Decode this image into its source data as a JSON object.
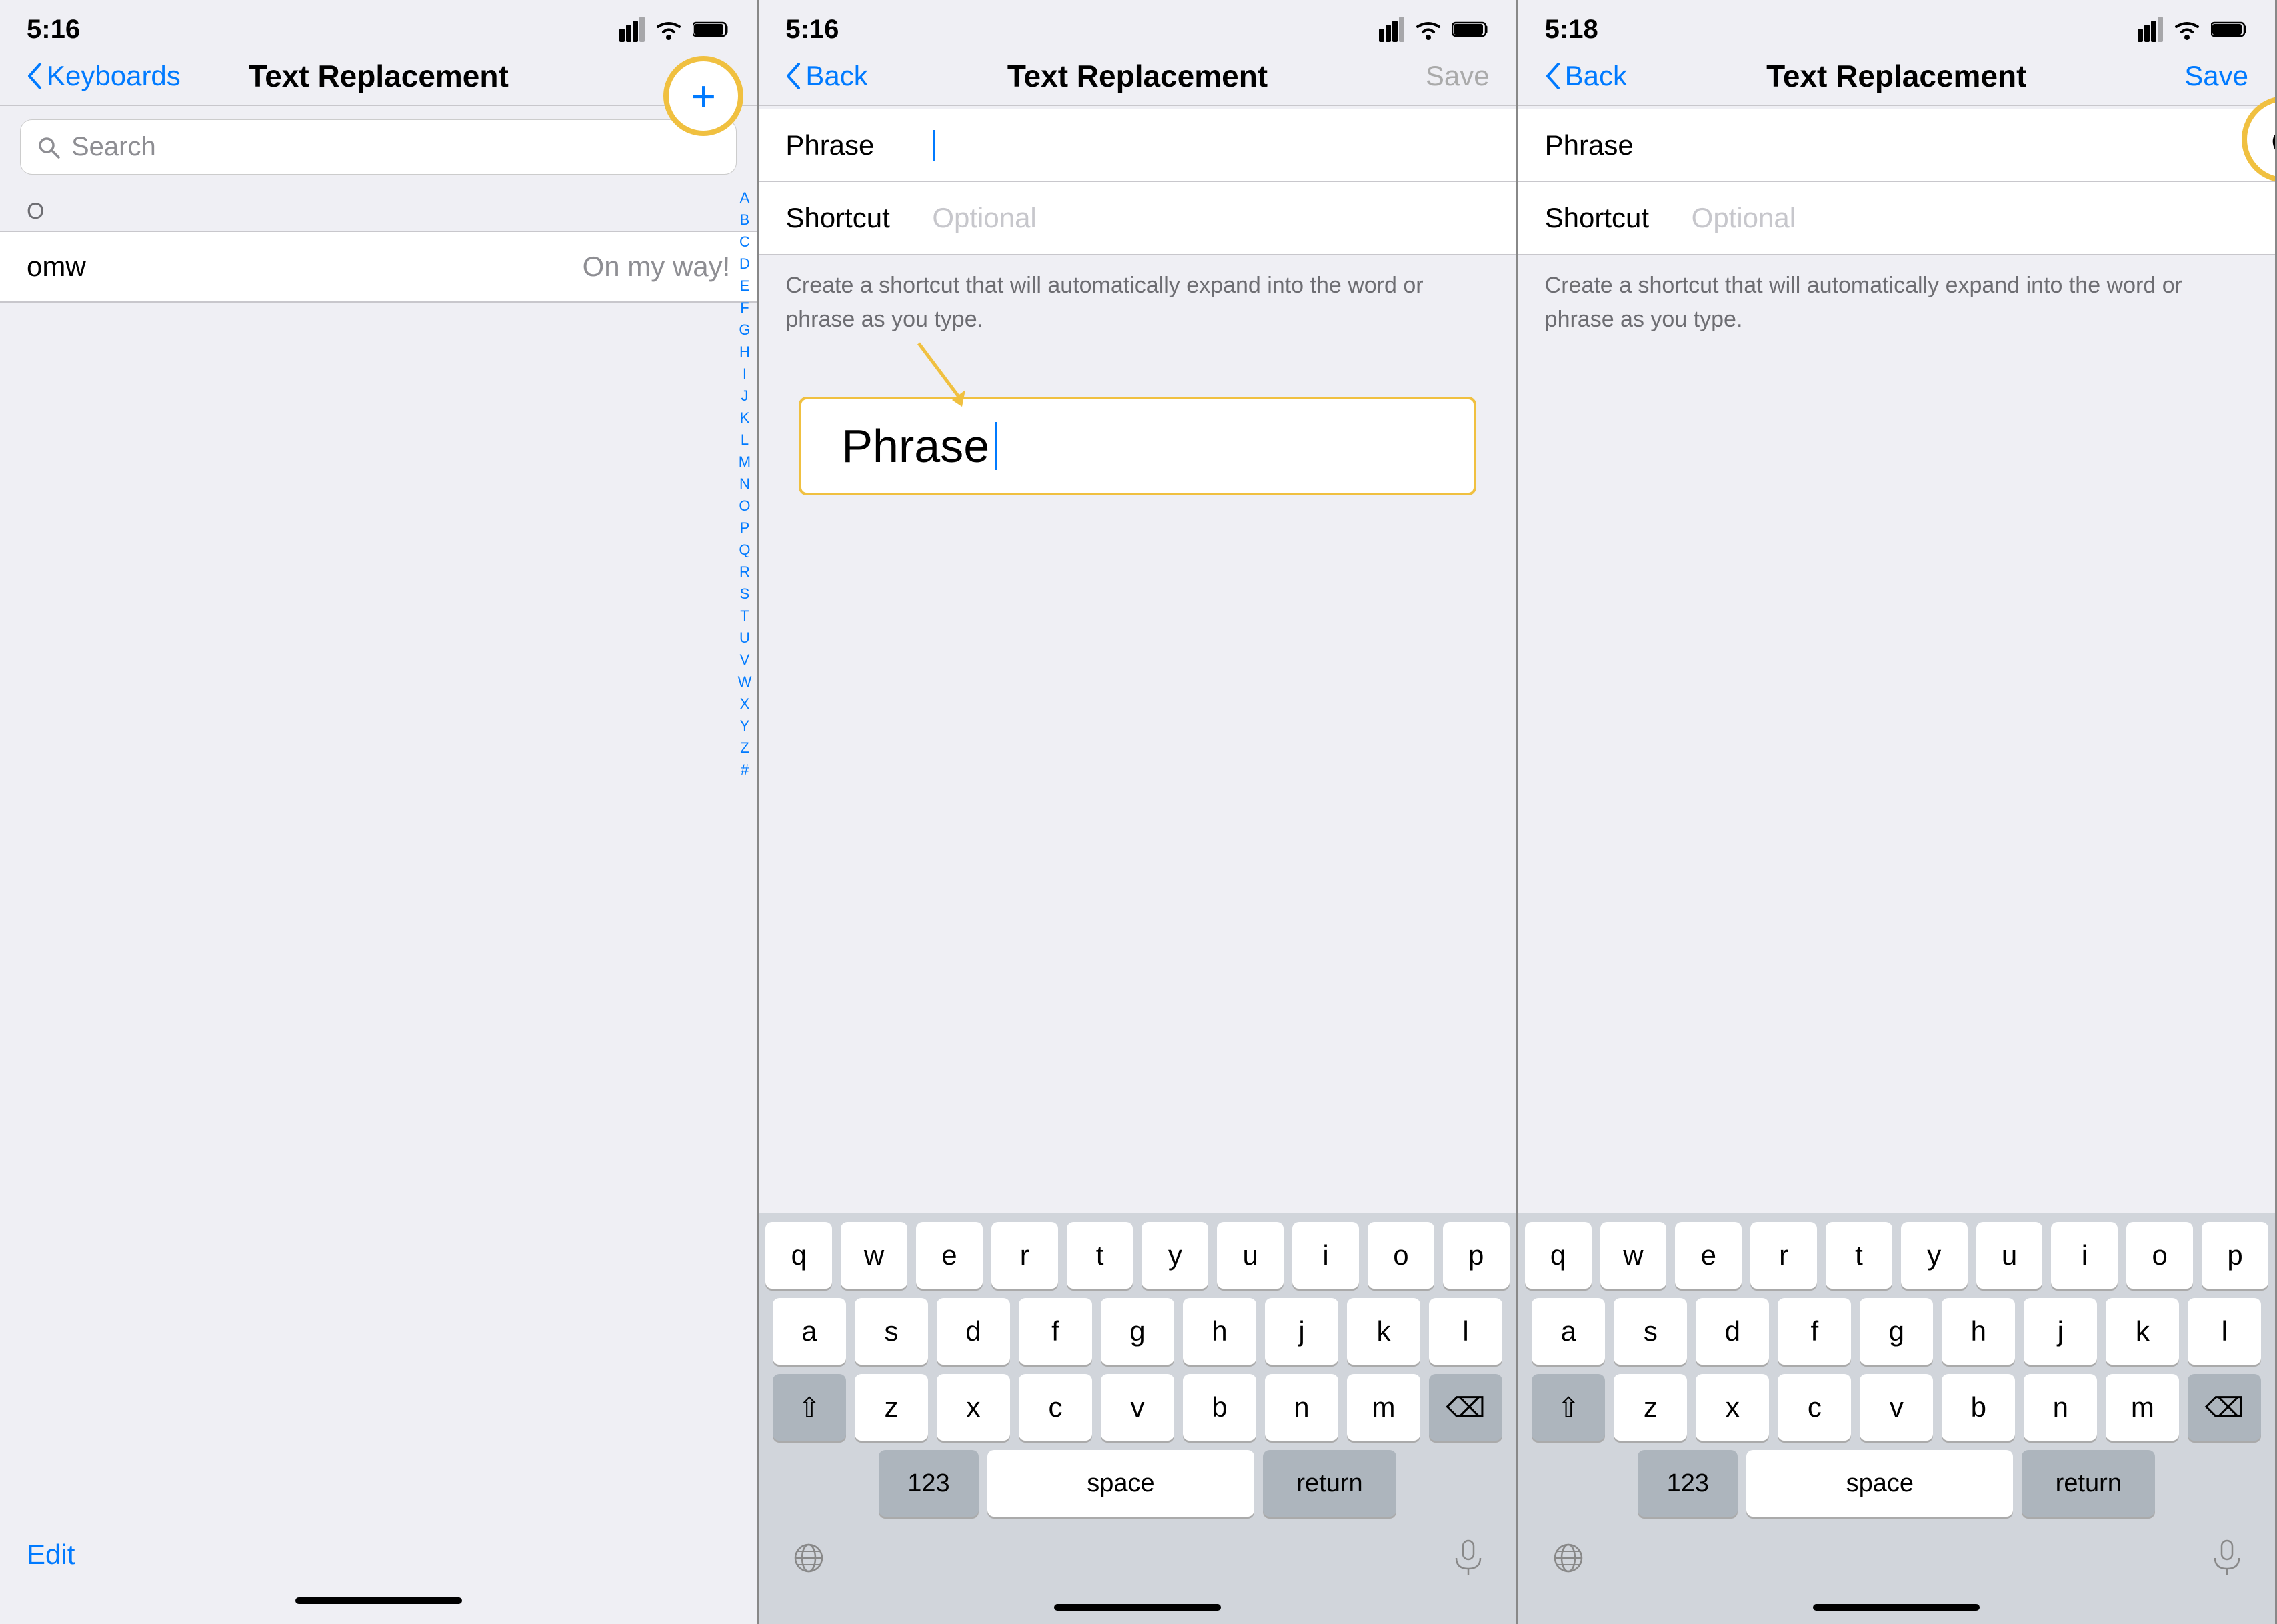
{
  "panels": [
    {
      "id": "panel1",
      "statusBar": {
        "time": "5:16",
        "hasLocation": true
      },
      "nav": {
        "back": "Keyboards",
        "title": "Text Replacement",
        "action": "+",
        "actionType": "add"
      },
      "search": {
        "placeholder": "Search"
      },
      "listSectionHeader": "O",
      "listItems": [
        {
          "label": "omw",
          "value": "On my way!"
        }
      ],
      "alphabetIndex": [
        "A",
        "B",
        "C",
        "D",
        "E",
        "F",
        "G",
        "H",
        "I",
        "J",
        "K",
        "L",
        "M",
        "N",
        "O",
        "P",
        "Q",
        "R",
        "S",
        "T",
        "U",
        "V",
        "W",
        "X",
        "Y",
        "Z",
        "#"
      ],
      "editLabel": "Edit",
      "annotationLabel": "+"
    },
    {
      "id": "panel2",
      "statusBar": {
        "time": "5:16",
        "hasLocation": true
      },
      "nav": {
        "back": "Back",
        "title": "Text Replacement",
        "action": "Save",
        "actionType": "save",
        "actionDisabled": true
      },
      "formRows": [
        {
          "label": "Phrase",
          "value": "",
          "placeholder": "",
          "hasCursor": true
        },
        {
          "label": "Shortcut",
          "value": "",
          "placeholder": "Optional",
          "hasCursor": false
        }
      ],
      "formDescription": "Create a shortcut that will automatically expand into the word or phrase as you type.",
      "phraseHighlight": {
        "text": "Phrase",
        "showCursor": true
      },
      "keyboard": {
        "rows": [
          [
            "q",
            "w",
            "e",
            "r",
            "t",
            "y",
            "u",
            "i",
            "o",
            "p"
          ],
          [
            "a",
            "s",
            "d",
            "f",
            "g",
            "h",
            "j",
            "k",
            "l"
          ],
          [
            "⇧",
            "z",
            "x",
            "c",
            "v",
            "b",
            "n",
            "m",
            "⌫"
          ],
          [
            "123",
            "space",
            "return"
          ]
        ]
      }
    },
    {
      "id": "panel3",
      "statusBar": {
        "time": "5:18",
        "hasLocation": true
      },
      "nav": {
        "back": "Back",
        "title": "Text Replacement",
        "action": "Save",
        "actionType": "save",
        "actionDisabled": false
      },
      "formRows": [
        {
          "label": "Phrase",
          "value": "",
          "placeholder": "",
          "hasCursor": false,
          "isApple": true
        },
        {
          "label": "Shortcut",
          "value": "",
          "placeholder": "Optional",
          "hasCursor": false
        }
      ],
      "formDescription": "Create a shortcut that will automatically expand into the word or phrase as you type.",
      "keyboard": {
        "rows": [
          [
            "q",
            "w",
            "e",
            "r",
            "t",
            "y",
            "u",
            "i",
            "o",
            "p"
          ],
          [
            "a",
            "s",
            "d",
            "f",
            "g",
            "h",
            "j",
            "k",
            "l"
          ],
          [
            "⇧",
            "z",
            "x",
            "c",
            "v",
            "b",
            "n",
            "m",
            "⌫"
          ],
          [
            "123",
            "space",
            "return"
          ]
        ]
      }
    }
  ]
}
